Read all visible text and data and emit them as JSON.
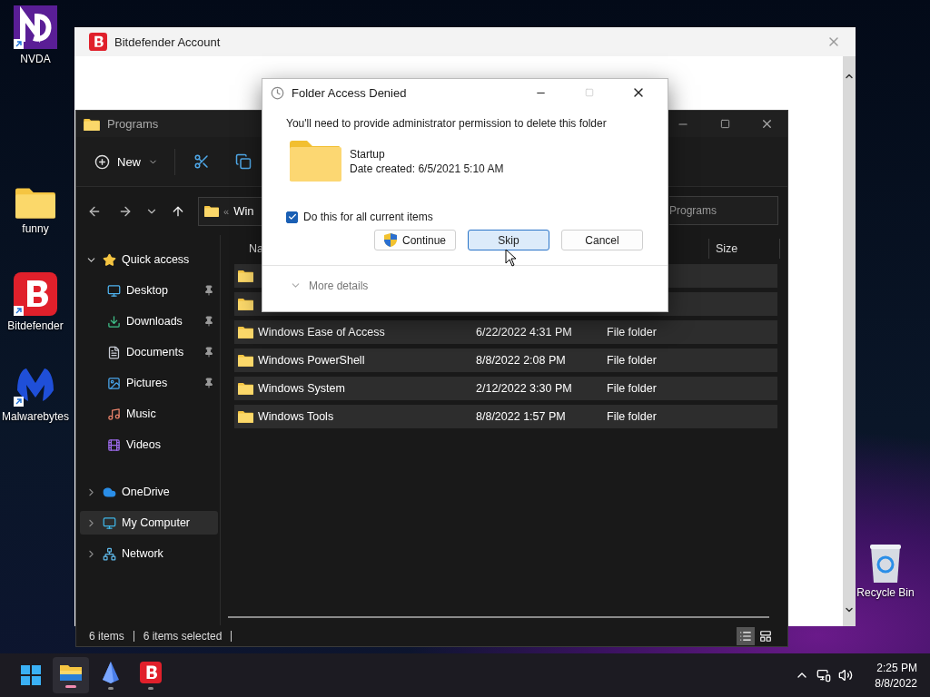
{
  "desktop_icons": [
    {
      "label": "NVDA",
      "kind": "nvda",
      "shortcut": true
    },
    {
      "label": "funny",
      "kind": "folder",
      "shortcut": false
    },
    {
      "label": "Bitdefender",
      "kind": "bitdefender",
      "shortcut": true
    },
    {
      "label": "Malwarebytes",
      "kind": "malwarebytes",
      "shortcut": true
    }
  ],
  "recycle_bin": {
    "label": "Recycle Bin"
  },
  "background_window": {
    "title": "Bitdefender Account"
  },
  "explorer": {
    "title": "Programs",
    "new_label": "New",
    "address_prefix": "«",
    "address": "Win",
    "search_placeholder": "Programs",
    "columns": [
      {
        "label": "Na"
      },
      {
        "label": "Size"
      }
    ],
    "sidebar": [
      {
        "label": "Quick access",
        "kind": "star",
        "expanded": true,
        "selected": false,
        "children": [
          {
            "label": "Desktop",
            "kind": "desktop",
            "pinned": true,
            "selected": false
          },
          {
            "label": "Downloads",
            "kind": "download",
            "pinned": true,
            "selected": false
          },
          {
            "label": "Documents",
            "kind": "documents",
            "pinned": true,
            "selected": false
          },
          {
            "label": "Pictures",
            "kind": "pictures",
            "pinned": true,
            "selected": false
          },
          {
            "label": "Music",
            "kind": "music",
            "pinned": false,
            "selected": false
          },
          {
            "label": "Videos",
            "kind": "videos",
            "pinned": false,
            "selected": false
          }
        ]
      },
      {
        "label": "OneDrive",
        "kind": "onedrive",
        "expanded": false,
        "selected": false
      },
      {
        "label": "My Computer",
        "kind": "computer",
        "expanded": false,
        "selected": true
      },
      {
        "label": "Network",
        "kind": "network",
        "expanded": false,
        "selected": false
      }
    ],
    "rows": [
      {
        "selected": true
      },
      {
        "selected": true
      },
      {
        "name": "Windows Ease of Access",
        "date": "6/22/2022 4:31 PM",
        "type": "File folder",
        "selected": true
      },
      {
        "name": "Windows PowerShell",
        "date": "8/8/2022 2:08 PM",
        "type": "File folder",
        "selected": true
      },
      {
        "name": "Windows System",
        "date": "2/12/2022 3:30 PM",
        "type": "File folder",
        "selected": true
      },
      {
        "name": "Windows Tools",
        "date": "8/8/2022 1:57 PM",
        "type": "File folder",
        "selected": true
      }
    ],
    "status": [
      "6 items",
      "6 items selected"
    ],
    "views": [
      {
        "kind": "details",
        "selected": true
      },
      {
        "kind": "tiles",
        "selected": false
      }
    ]
  },
  "dialog": {
    "title": "Folder Access Denied",
    "message": "You'll need to provide administrator permission to delete this folder",
    "item_name": "Startup",
    "item_date": "Date created: 6/5/2021 5:10 AM",
    "checkbox": {
      "label": "Do this for all current items",
      "checked": true
    },
    "buttons": [
      {
        "label": "Continue",
        "kind": "shield",
        "selected": false
      },
      {
        "label": "Skip",
        "kind": "plain",
        "selected": true
      },
      {
        "label": "Cancel",
        "kind": "plain",
        "selected": false
      }
    ],
    "more_details": "More details"
  },
  "taskbar": {
    "apps": [
      {
        "kind": "explorer",
        "active": true
      },
      {
        "kind": "crystal",
        "active": false
      },
      {
        "kind": "bitdefender",
        "active": false
      }
    ],
    "time": "2:25 PM",
    "date": "8/8/2022"
  }
}
